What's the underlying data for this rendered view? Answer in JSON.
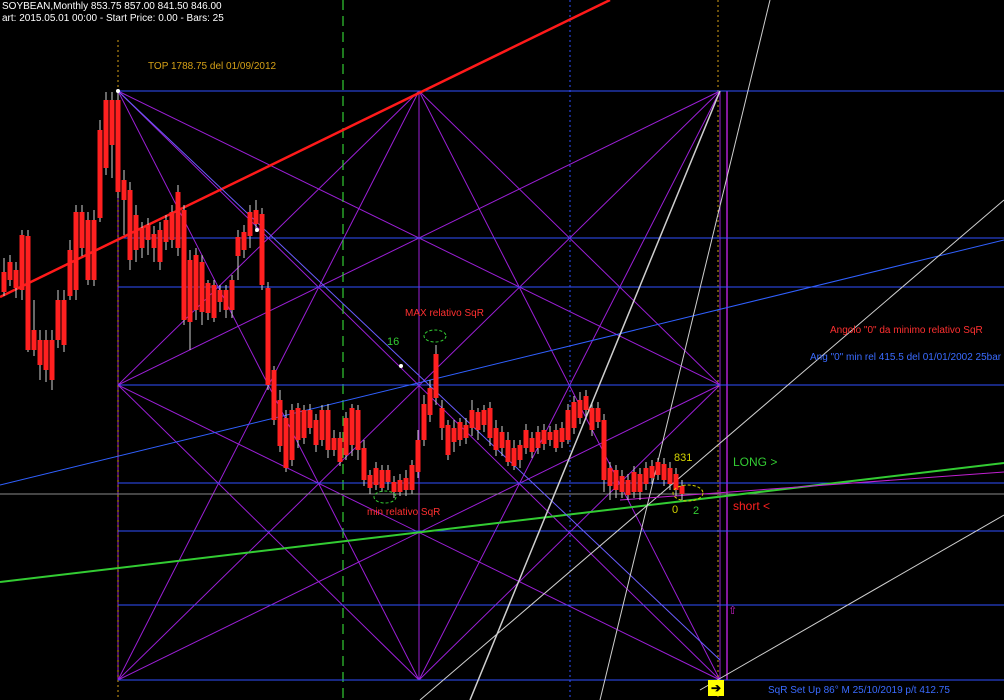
{
  "header": {
    "line1": "SOYBEAN,Monthly  853.75 857.00 841.50 846.00",
    "line2": "art: 2015.05.01 00:00 - Start Price: 0.00 - Bars: 25"
  },
  "annotations": {
    "top": "TOP 1788.75 del 01/09/2012",
    "max_rel": "MAX relativo SqR",
    "min_rel": "min relativo SqR",
    "angolo": "Angolo \"0\" da minimo relativo SqR",
    "ang_min": "Ang \"0\" min rel 415.5 del 01/01/2002 25bar",
    "long": "LONG >",
    "short": "short <",
    "num16": "16",
    "num831": "831",
    "num2": "2",
    "num0": "0",
    "setup": "SqR Set Up 86° M 25/10/2019 p/t 412.75"
  },
  "colors": {
    "background": "#000000",
    "bull": "#00c000",
    "bear": "#ff2020",
    "grid": "#9b1fd6",
    "blue_lines": "#3050ff",
    "green_trend": "#33cc33",
    "red_trend": "#ff1a1a"
  },
  "chart_data": {
    "type": "candlestick",
    "symbol": "SOYBEAN",
    "timeframe": "Monthly",
    "last_bar": {
      "open": 853.75,
      "high": 857.0,
      "low": 841.5,
      "close": 846.0
    }
  }
}
